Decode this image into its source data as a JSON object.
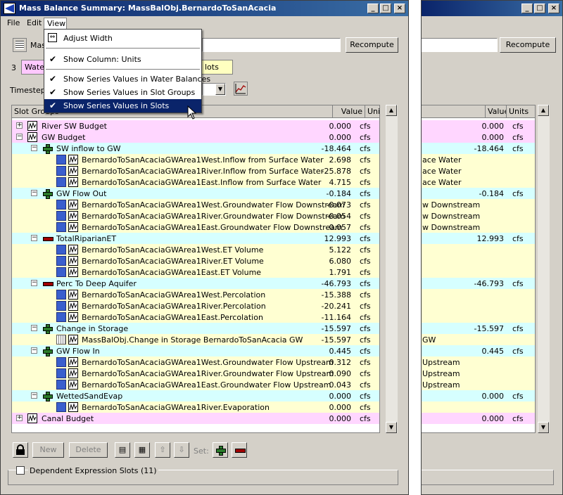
{
  "window": {
    "title": "Mass Balance Summary: MassBalObj.BernardoToSanAcacia",
    "minimize": "_",
    "maximize": "□",
    "close": "×"
  },
  "menu": {
    "file": "File",
    "edit": "Edit",
    "view": "View"
  },
  "view_menu": {
    "items": [
      {
        "label": "Adjust Width",
        "checked": false
      },
      {
        "label": "Show Column: Units",
        "checked": true
      },
      {
        "label": "Show Series Values in Water Balances",
        "checked": true
      },
      {
        "label": "Show Series Values in Slot Groups",
        "checked": true
      },
      {
        "label": "Show Series Values in Slots",
        "checked": true
      }
    ]
  },
  "toolbar": {
    "name_label_prefix": "Mas",
    "recompute": "Recompute",
    "count": "3",
    "tab_water": "Water",
    "tab_slots": "lots",
    "timestep_label": "Timestep:"
  },
  "table": {
    "col_slot_groups": "Slot Groups",
    "col_value": "Value",
    "col_units": "Units",
    "rows": [
      {
        "label": "River SW Budget",
        "value": "0.000",
        "units": "cfs"
      },
      {
        "label": "GW Budget",
        "value": "0.000",
        "units": "cfs"
      },
      {
        "label": "SW inflow to GW",
        "value": "-18.464",
        "units": "cfs"
      },
      {
        "label": "BernardoToSanAcaciaGWArea1West.Inflow from Surface Water",
        "value": "2.698",
        "units": "cfs"
      },
      {
        "label": "BernardoToSanAcaciaGWArea1River.Inflow from Surface Water",
        "value": "-25.878",
        "units": "cfs"
      },
      {
        "label": "BernardoToSanAcaciaGWArea1East.Inflow from Surface Water",
        "value": "4.715",
        "units": "cfs"
      },
      {
        "label": "GW Flow Out",
        "value": "-0.184",
        "units": "cfs"
      },
      {
        "label": "BernardoToSanAcaciaGWArea1West.Groundwater Flow Downstream",
        "value": "-0.073",
        "units": "cfs"
      },
      {
        "label": "BernardoToSanAcaciaGWArea1River.Groundwater Flow Downstream",
        "value": "-0.054",
        "units": "cfs"
      },
      {
        "label": "BernardoToSanAcaciaGWArea1East.Groundwater Flow Downstream",
        "value": "-0.057",
        "units": "cfs"
      },
      {
        "label": "TotalRiparianET",
        "value": "12.993",
        "units": "cfs"
      },
      {
        "label": "BernardoToSanAcaciaGWArea1West.ET Volume",
        "value": "5.122",
        "units": "cfs"
      },
      {
        "label": "BernardoToSanAcaciaGWArea1River.ET Volume",
        "value": "6.080",
        "units": "cfs"
      },
      {
        "label": "BernardoToSanAcaciaGWArea1East.ET Volume",
        "value": "1.791",
        "units": "cfs"
      },
      {
        "label": "Perc To Deep Aquifer",
        "value": "-46.793",
        "units": "cfs"
      },
      {
        "label": "BernardoToSanAcaciaGWArea1West.Percolation",
        "value": "-15.388",
        "units": "cfs"
      },
      {
        "label": "BernardoToSanAcaciaGWArea1River.Percolation",
        "value": "-20.241",
        "units": "cfs"
      },
      {
        "label": "BernardoToSanAcaciaGWArea1East.Percolation",
        "value": "-11.164",
        "units": "cfs"
      },
      {
        "label": "Change in Storage",
        "value": "-15.597",
        "units": "cfs"
      },
      {
        "label": "MassBalObj.Change in Storage BernardoToSanAcacia GW",
        "value": "-15.597",
        "units": "cfs"
      },
      {
        "label": "GW Flow In",
        "value": "0.445",
        "units": "cfs"
      },
      {
        "label": "BernardoToSanAcaciaGWArea1West.Groundwater Flow Upstream",
        "value": "0.312",
        "units": "cfs"
      },
      {
        "label": "BernardoToSanAcaciaGWArea1River.Groundwater Flow Upstream",
        "value": "0.090",
        "units": "cfs"
      },
      {
        "label": "BernardoToSanAcaciaGWArea1East.Groundwater Flow Upstream",
        "value": "0.043",
        "units": "cfs"
      },
      {
        "label": "WettedSandEvap",
        "value": "0.000",
        "units": "cfs"
      },
      {
        "label": "BernardoToSanAcaciaGWArea1River.Evaporation",
        "value": "0.000",
        "units": "cfs"
      },
      {
        "label": "Canal Budget",
        "value": "0.000",
        "units": "cfs"
      }
    ]
  },
  "bottom": {
    "new": "New",
    "delete": "Delete",
    "set_label": "Set:",
    "dependent": "Dependent Expression Slots (11)"
  },
  "back_window": {
    "recompute": "Recompute",
    "col_value": "Value",
    "col_units": "Units",
    "frag_sw_water": "ace Water",
    "frag_downstream": "w Downstream",
    "frag_gw": "GW",
    "frag_upstream": "Upstream"
  }
}
